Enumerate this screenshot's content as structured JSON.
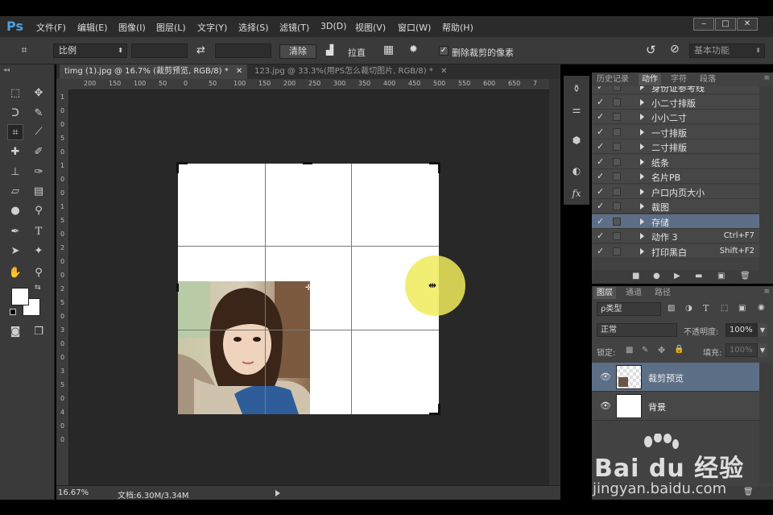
{
  "app": {
    "logo": "Ps",
    "menu": [
      "文件(F)",
      "编辑(E)",
      "图像(I)",
      "图层(L)",
      "文字(Y)",
      "选择(S)",
      "滤镜(T)",
      "3D(D)",
      "视图(V)",
      "窗口(W)",
      "帮助(H)"
    ],
    "window_buttons": [
      "‒",
      "□",
      "✕"
    ]
  },
  "options": {
    "ratio": "比例",
    "clear_label": "清除",
    "straighten_label": "拉直",
    "delete_cropped_label": "删除裁剪的像素",
    "delete_cropped_checked": true,
    "workspace": "基本功能"
  },
  "document": {
    "tabs": [
      {
        "title": "timg (1).jpg @ 16.7% (裁剪预览, RGB/8) *",
        "active": true
      },
      {
        "title": "123.jpg @ 33.3%(用PS怎么裁切图片, RGB/8) *",
        "active": false
      }
    ],
    "ruler_h": [
      "200",
      "150",
      "100",
      "50",
      "0",
      "50",
      "100",
      "150",
      "200",
      "250",
      "300",
      "350",
      "400",
      "450",
      "500",
      "550",
      "600",
      "650",
      "7"
    ],
    "ruler_v": [
      "1",
      "0",
      "0",
      "5",
      "0",
      "1",
      "0",
      "0",
      "1",
      "5",
      "0",
      "2",
      "0",
      "0",
      "2",
      "5",
      "0",
      "3",
      "0",
      "0",
      "3",
      "5",
      "0",
      "4",
      "0",
      "0"
    ],
    "zoom": "16.67%",
    "doc_size": "文档:6.30M/3.34M"
  },
  "actions_panel": {
    "tabs": [
      "历史记录",
      "动作",
      "字符",
      "段落"
    ],
    "active_tab": 1,
    "rows": [
      {
        "label": "身份证参考线",
        "key": "",
        "selected": false
      },
      {
        "label": "小二寸排版",
        "key": "",
        "selected": false
      },
      {
        "label": "小小二寸",
        "key": "",
        "selected": false
      },
      {
        "label": "一寸排版",
        "key": "",
        "selected": false
      },
      {
        "label": "二寸排版",
        "key": "",
        "selected": false
      },
      {
        "label": "纸条",
        "key": "",
        "selected": false
      },
      {
        "label": "名片PB",
        "key": "",
        "selected": false
      },
      {
        "label": "户口内页大小",
        "key": "",
        "selected": false
      },
      {
        "label": "裁图",
        "key": "",
        "selected": false
      },
      {
        "label": "存储",
        "key": "",
        "selected": true
      },
      {
        "label": "动作 3",
        "key": "Ctrl+F7",
        "selected": false
      },
      {
        "label": "打印黑白",
        "key": "Shift+F2",
        "selected": false
      }
    ]
  },
  "layers_panel": {
    "tabs": [
      "图层",
      "通道",
      "路径"
    ],
    "active_tab": 0,
    "filter": "ρ类型",
    "blend_mode": "正常",
    "opacity_label": "不透明度:",
    "opacity": "100%",
    "lock_label": "锁定:",
    "fill_label": "填充:",
    "fill": "100%",
    "layers": [
      {
        "name": "裁剪预览",
        "selected": true
      },
      {
        "name": "背景",
        "selected": false
      }
    ]
  },
  "watermark": {
    "brand": "Bai du 经验",
    "url": "jingyan.baidu.com"
  },
  "colors": {
    "accent_blue": "#4d9fe0",
    "selection": "#5d6f87",
    "cursor_halo": "#f0eb5a"
  }
}
